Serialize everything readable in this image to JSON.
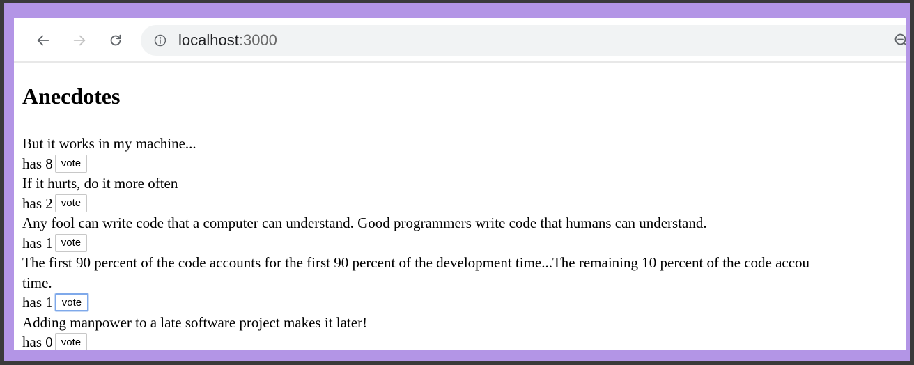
{
  "browser": {
    "url_host": "localhost",
    "url_port": ":3000"
  },
  "page": {
    "heading": "Anecdotes",
    "anecdotes": [
      {
        "text": "But it works in my machine...",
        "votes_label": "has 8",
        "button_label": "vote"
      },
      {
        "text": "If it hurts, do it more often",
        "votes_label": "has 2",
        "button_label": "vote"
      },
      {
        "text": "Any fool can write code that a computer can understand. Good programmers write code that humans can understand.",
        "votes_label": "has 1",
        "button_label": "vote"
      },
      {
        "text": "The first 90 percent of the code accounts for the first 90 percent of the development time...The remaining 10 percent of the code accou",
        "text_line2": "time.",
        "votes_label": "has 1",
        "button_label": "vote"
      },
      {
        "text": "Adding manpower to a late software project makes it later!",
        "votes_label": "has 0",
        "button_label": "vote"
      }
    ]
  },
  "icons": {
    "back": "arrow-left-icon",
    "forward": "arrow-right-icon",
    "reload": "reload-icon",
    "info": "info-circle-icon",
    "zoom": "zoom-icon"
  },
  "colors": {
    "frame": "#b395e6",
    "focus_ring": "#7fa9ea"
  }
}
